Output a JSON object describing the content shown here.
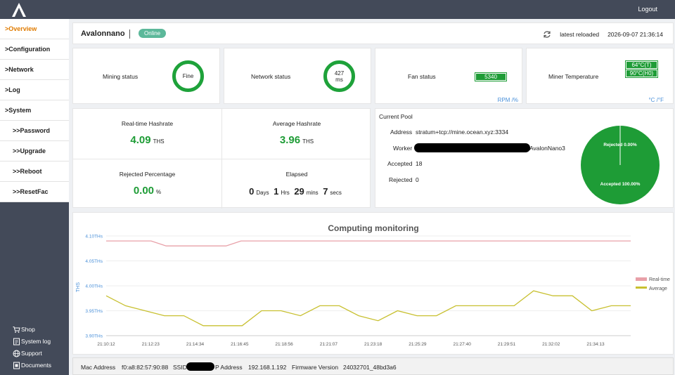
{
  "topbar": {
    "logout_label": "Logout"
  },
  "sidebar": {
    "items": [
      {
        "label": ">Overview",
        "active": true
      },
      {
        "label": ">Configuration"
      },
      {
        "label": ">Network"
      },
      {
        "label": ">Log"
      },
      {
        "label": ">System"
      },
      {
        "label": ">>Password"
      },
      {
        "label": ">>Upgrade"
      },
      {
        "label": ">>Reboot"
      },
      {
        "label": ">>ResetFac"
      }
    ],
    "links": [
      {
        "label": "Shop",
        "icon": "cart-icon"
      },
      {
        "label": "System log",
        "icon": "log-icon"
      },
      {
        "label": "Support",
        "icon": "globe-icon"
      },
      {
        "label": "Documents",
        "icon": "document-icon"
      }
    ]
  },
  "header": {
    "device_name": "Avalonnano",
    "status": "Online",
    "reload_label": "latest reloaded",
    "reload_time": "2026-09-07 21:36:14"
  },
  "status": {
    "mining_label": "Mining status",
    "mining_value": "Fine",
    "network_label": "Network status",
    "network_value": "427",
    "network_unit": "ms",
    "fan_label": "Fan status",
    "fan_value": "5340",
    "fan_unit": "RPM /%",
    "temp_label": "Miner Temperature",
    "temp_t": "64°C(T)",
    "temp_h": "90°C(H0)",
    "temp_unit": "°C /°F"
  },
  "hashrate": {
    "realtime_label": "Real-time Hashrate",
    "realtime_value": "4.09",
    "realtime_unit": "THS",
    "average_label": "Average Hashrate",
    "average_value": "3.96",
    "average_unit": "THS",
    "rejected_label": "Rejected Percentage",
    "rejected_value": "0.00",
    "rejected_unit": "%",
    "elapsed_label": "Elapsed",
    "days": "0",
    "days_unit": "Days",
    "hrs": "1",
    "hrs_unit": "Hrs",
    "mins": "29",
    "mins_unit": "mins",
    "secs": "7",
    "secs_unit": "secs"
  },
  "pool": {
    "title": "Current Pool",
    "address_label": "Address",
    "address_value": "stratum+tcp://mine.ocean.xyz:3334",
    "worker_label": "Worker",
    "worker_value": "AvalonNano3",
    "accepted_label": "Accepted",
    "accepted_value": "18",
    "rejected_label": "Rejected",
    "rejected_value": "0",
    "pie_rejected_label": "Rejected 0.00%",
    "pie_accepted_label": "Accepted 100.00%"
  },
  "chart_data": {
    "type": "line",
    "title": "Computing monitoring",
    "ylabel": "THS",
    "ylim": [
      3.9,
      4.1
    ],
    "yticks": [
      "3.90THs",
      "3.95THs",
      "4.00THs",
      "4.05THs",
      "4.10THs"
    ],
    "xtick_labels": [
      "21:10:12",
      "21:12:23",
      "21:14:34",
      "21:16:45",
      "21:18:56",
      "21:21:07",
      "21:23:18",
      "21:25:29",
      "21:27:40",
      "21:29:51",
      "21:32:02",
      "21:34:13"
    ],
    "legend": "right",
    "colors": {
      "realtime": "#e8a0a8",
      "average": "#c8c030"
    },
    "series": [
      {
        "name": "Real-time",
        "values": [
          4.09,
          4.09,
          4.09,
          4.09,
          4.08,
          4.08,
          4.08,
          4.08,
          4.08,
          4.09,
          4.09,
          4.09,
          4.09,
          4.09,
          4.09,
          4.09,
          4.09,
          4.09,
          4.09,
          4.09,
          4.09,
          4.09,
          4.09,
          4.09,
          4.09,
          4.09,
          4.09,
          4.09,
          4.09,
          4.09,
          4.09,
          4.09,
          4.09,
          4.09,
          4.09,
          4.09
        ]
      },
      {
        "name": "Average",
        "values": [
          3.98,
          3.96,
          3.95,
          3.94,
          3.94,
          3.92,
          3.92,
          3.92,
          3.95,
          3.95,
          3.94,
          3.96,
          3.96,
          3.94,
          3.93,
          3.95,
          3.94,
          3.94,
          3.96,
          3.96,
          3.96,
          3.96,
          3.99,
          3.98,
          3.98,
          3.95,
          3.96,
          3.96
        ]
      }
    ]
  },
  "footer": {
    "mac_label": "Mac Address",
    "mac_value": "f0:a8:82:57:90:88",
    "ssid_label": "SSID",
    "ip_label": "P Address",
    "ip_value": "192.168.1.192",
    "fw_label": "Firmware Version",
    "fw_value": "24032701_48bd3a6"
  }
}
